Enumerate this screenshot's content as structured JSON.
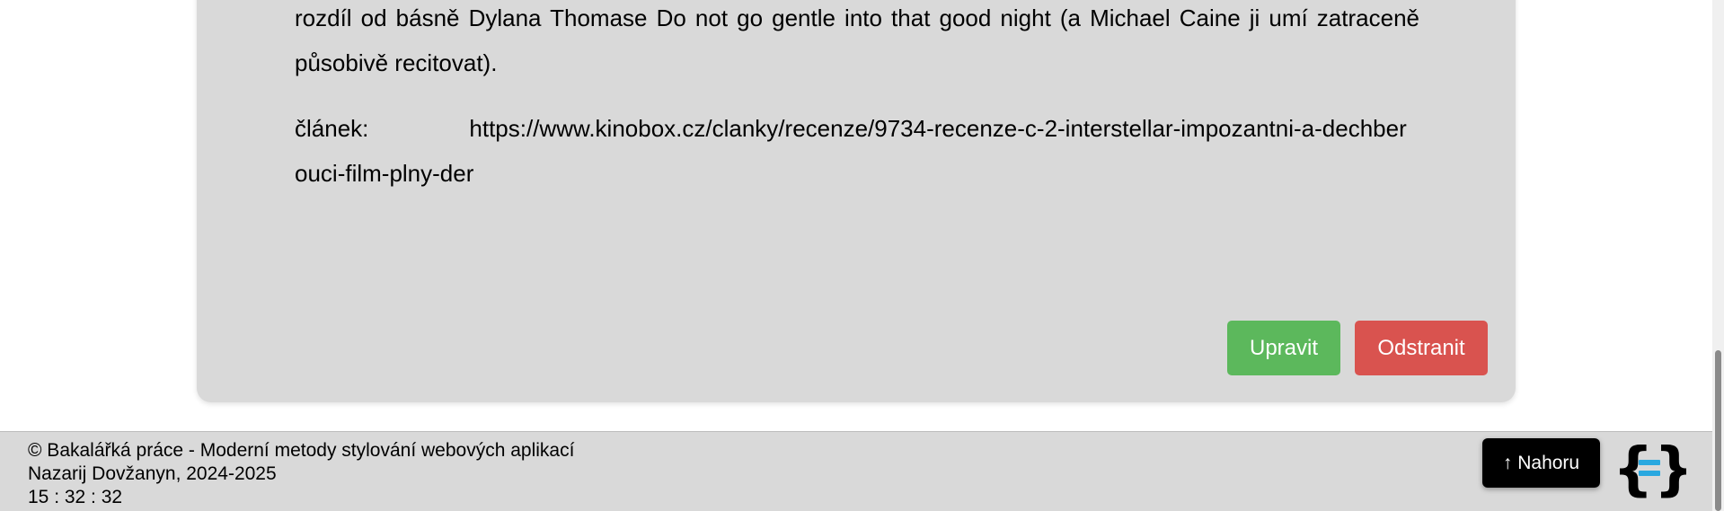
{
  "review": {
    "text": "rozdíl od básně Dylana Thomase Do not go gentle into that good night (a Michael Caine ji umí zatraceně působivě recitovat).",
    "article_label": "článek:",
    "article_url": "https://www.kinobox.cz/clanky/recenze/9734-recenze-c-2-interstellar-impozantni-a-dechberouci-film-plny-der"
  },
  "actions": {
    "edit_label": "Upravit",
    "delete_label": "Odstranit"
  },
  "footer": {
    "line1": "© Bakalářká práce - Moderní metody stylování webových aplikací",
    "line2": "Nazarij Dovžanyn, 2024-2025",
    "clock": "15 : 32 : 32",
    "top_button_label": "↑ Nahoru"
  },
  "colors": {
    "card_bg": "#d9d9d9",
    "edit": "#5cb85c",
    "delete": "#d9534f",
    "logo_braces": "#000000",
    "logo_equals": "#29a8e0"
  },
  "icons": {
    "logo": "curly-braces-equals-logo"
  }
}
